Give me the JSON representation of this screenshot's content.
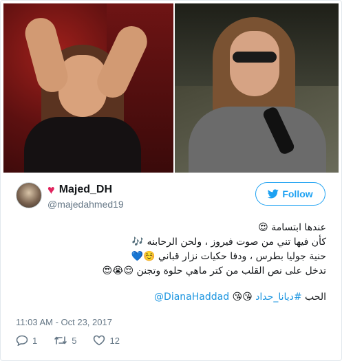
{
  "user": {
    "display_name": "Majed_DH",
    "handle": "@majedahmed19",
    "heart": "♥"
  },
  "follow": {
    "label": "Follow"
  },
  "tweet": {
    "lines": [
      "عندها ابتسامة 😍",
      "كأن فيها تني من صوت فيروز ، ولحن الرحابنه 🎶",
      "حنية جوليا بطرس ، ودفا حكيات نزار قباني ☺️💙",
      "تدخل على نص القلب من كتر ماهي حلوة وتجنن 😌😭😍"
    ],
    "tags_prefix": "الحب ",
    "hashtag": "#ديانا_حداد",
    "emojis": " 😘😘 ",
    "mention": "@DianaHaddad"
  },
  "timestamp": "11:03 AM - Oct 23, 2017",
  "actions": {
    "reply_count": "1",
    "retweet_count": "5",
    "like_count": "12"
  },
  "colors": {
    "accent": "#1da1f2",
    "heart": "#e0245e",
    "muted": "#657786"
  }
}
